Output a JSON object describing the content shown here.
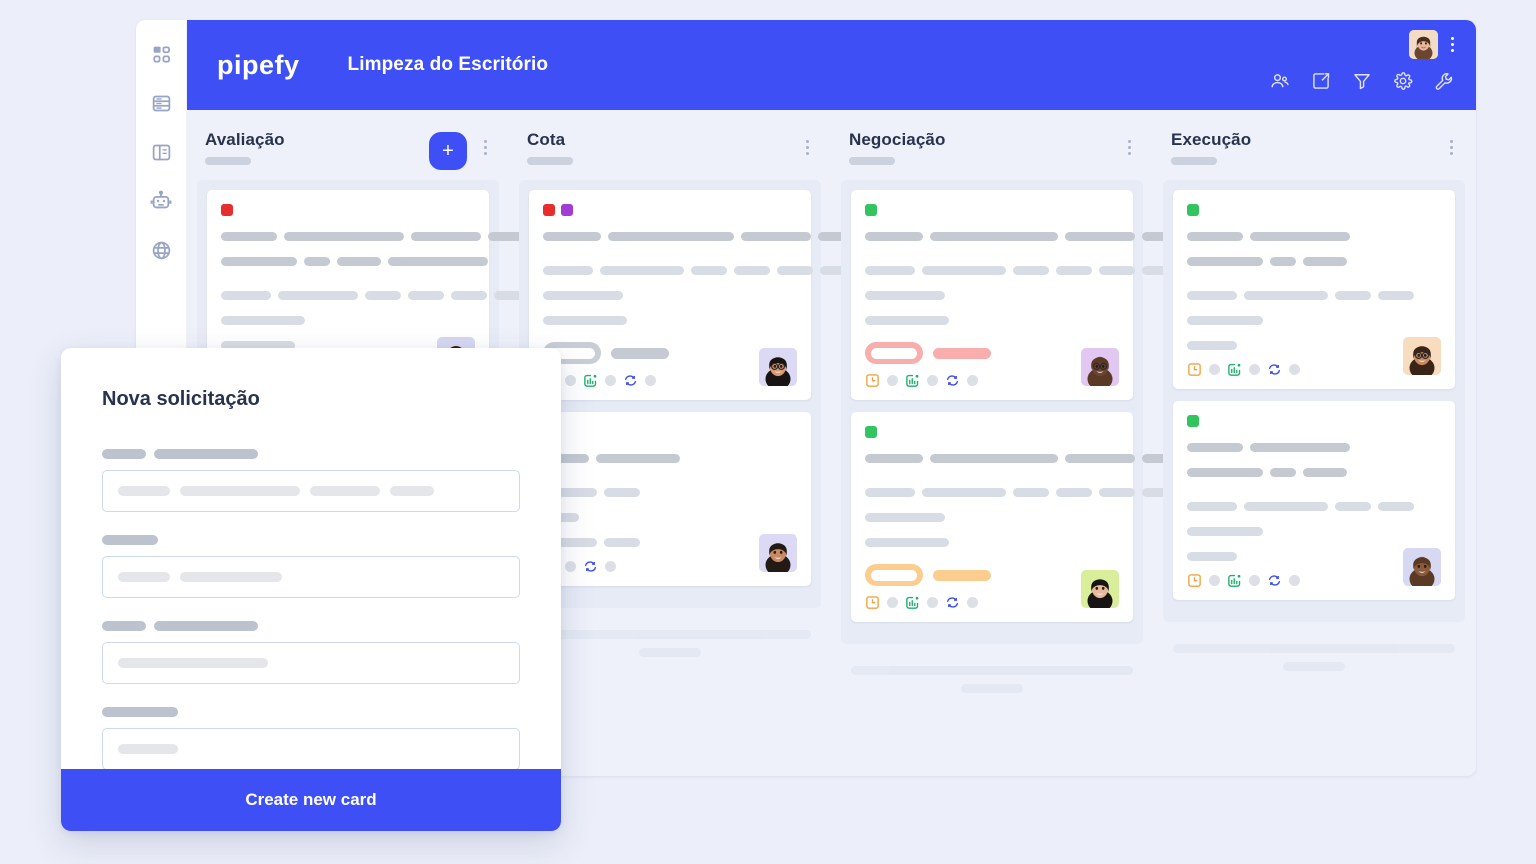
{
  "app": {
    "logo_text": "pipefy",
    "board_title": "Limpeza do Escritório"
  },
  "sidebar": {
    "items": [
      {
        "icon": "grid-icon",
        "name": "sidebar-item-dashboard"
      },
      {
        "icon": "database-icon",
        "name": "sidebar-item-database"
      },
      {
        "icon": "layout-icon",
        "name": "sidebar-item-portal"
      },
      {
        "icon": "robot-icon",
        "name": "sidebar-item-automation"
      },
      {
        "icon": "globe-icon",
        "name": "sidebar-item-public"
      }
    ]
  },
  "topbar": {
    "tools": [
      {
        "icon": "members-icon",
        "name": "members-button"
      },
      {
        "icon": "inbox-arrow-icon",
        "name": "import-button"
      },
      {
        "icon": "filter-icon",
        "name": "filter-button"
      },
      {
        "icon": "gear-icon",
        "name": "settings-button"
      },
      {
        "icon": "wrench-icon",
        "name": "tools-button"
      }
    ],
    "avatar_bg": "#f3dcc4",
    "kebab": "more-options-icon"
  },
  "colors": {
    "brand": "#3d4ff5",
    "page_bg": "#eceff9",
    "board_bg": "#eef1f9",
    "column_bg": "#e7ebf6",
    "title_text": "#28334e",
    "skeleton_dark": "#c4c9d2",
    "skeleton_light": "#d8dce4",
    "tag_red": "#e62e2e",
    "tag_purple": "#a23cd4",
    "tag_green": "#32c45f",
    "pill_pink": "#f9aeae",
    "pill_amber": "#fbcd8e",
    "pill_grey": "#c8cdd6"
  },
  "board": {
    "add_button_label": "+",
    "columns": [
      {
        "title": "Avaliação",
        "has_add_button": true,
        "cards": [
          {
            "tags": [
              "#e62e2e"
            ],
            "lines": [
              [
                56,
                120,
                70,
                44
              ],
              [
                76,
                26,
                44,
                100
              ]
            ],
            "lines2": [
              [
                50,
                80,
                36,
                36,
                36,
                48
              ],
              [
                84
              ],
              [
                74
              ]
            ],
            "pill": null,
            "footer_icons": [
              "clock-icon",
              "checklist-icon",
              "connection-icon"
            ],
            "avatar_bg": "#d6d8f2"
          },
          {
            "tags": [],
            "lines": [],
            "lines2": [],
            "pill": null,
            "footer_icons": [],
            "avatar_bg": "#d6d8f2",
            "occluded": true
          }
        ]
      },
      {
        "title": "Cota",
        "has_add_button": false,
        "cards": [
          {
            "tags": [
              "#e62e2e",
              "#a23cd4"
            ],
            "lines": [
              [
                58,
                126,
                70,
                46
              ]
            ],
            "lines2": [
              [
                50,
                84,
                36,
                36,
                36,
                44
              ],
              [
                80
              ],
              [
                84
              ]
            ],
            "pill": {
              "color": "#c8cdd6",
              "inner": 46,
              "bar": 58,
              "bar_color": "#c4c9d2"
            },
            "footer_icons": [
              "clock-icon",
              "checklist-icon",
              "sync-icon"
            ],
            "avatar_bg": "#dcd9f4"
          },
          {
            "tags": [],
            "lines": [
              [
                46,
                84
              ]
            ],
            "lines2": [
              [
                54,
                36
              ],
              [
                36
              ],
              [
                54,
                36
              ]
            ],
            "pill": null,
            "footer_icons": [
              "checklist-icon",
              "sync-icon"
            ],
            "avatar_bg": "#dcd9f4",
            "occluded": true
          }
        ]
      },
      {
        "title": "Negociação",
        "has_add_button": false,
        "cards": [
          {
            "tags": [
              "#32c45f"
            ],
            "lines": [
              [
                58,
                128,
                70,
                46
              ]
            ],
            "lines2": [
              [
                50,
                84,
                36,
                36,
                36,
                44
              ],
              [
                80
              ],
              [
                84
              ]
            ],
            "pill": {
              "color": "#f9aeae",
              "inner": 46,
              "bar": 58,
              "bar_color": "#f9aeae"
            },
            "footer_icons": [
              "clock-icon",
              "checklist-icon",
              "sync-icon"
            ],
            "avatar_bg": "#e2c7f3"
          },
          {
            "tags": [
              "#32c45f"
            ],
            "lines": [
              [
                58,
                128,
                70,
                46
              ]
            ],
            "lines2": [
              [
                50,
                84,
                36,
                36,
                36,
                44
              ],
              [
                80
              ],
              [
                84
              ]
            ],
            "pill": {
              "color": "#fbcd8e",
              "inner": 46,
              "bar": 58,
              "bar_color": "#fbcd8e"
            },
            "footer_icons": [
              "clock-icon",
              "checklist-icon",
              "sync-icon"
            ],
            "avatar_bg": "#d9ee9a"
          }
        ]
      },
      {
        "title": "Execução",
        "has_add_button": false,
        "cards": [
          {
            "tags": [
              "#32c45f"
            ],
            "lines": [
              [
                56,
                100
              ],
              [
                76,
                26,
                44
              ]
            ],
            "lines2": [
              [
                50,
                84,
                36,
                36
              ],
              [
                76
              ],
              [
                50
              ]
            ],
            "pill": null,
            "footer_icons": [
              "clock-icon",
              "checklist-icon",
              "sync-icon"
            ],
            "avatar_bg": "#f7dcc0"
          },
          {
            "tags": [
              "#32c45f"
            ],
            "lines": [
              [
                56,
                100
              ],
              [
                76,
                26,
                44
              ]
            ],
            "lines2": [
              [
                50,
                84,
                36,
                36
              ],
              [
                76
              ],
              [
                50
              ]
            ],
            "pill": null,
            "footer_icons": [
              "clock-icon",
              "checklist-icon",
              "sync-icon"
            ],
            "avatar_bg": "#d7d9f3"
          }
        ]
      }
    ]
  },
  "modal": {
    "title": "Nova solicitação",
    "cta_label": "Create new card",
    "fields": [
      {
        "label_bars": [
          44,
          104
        ],
        "input_bars": [
          52,
          120,
          70,
          44
        ]
      },
      {
        "label_bars": [
          56
        ],
        "input_bars": [
          52,
          102
        ]
      },
      {
        "label_bars": [
          44,
          104
        ],
        "input_bars": [
          150
        ]
      },
      {
        "label_bars": [
          76
        ],
        "input_bars": [
          60
        ]
      }
    ]
  }
}
